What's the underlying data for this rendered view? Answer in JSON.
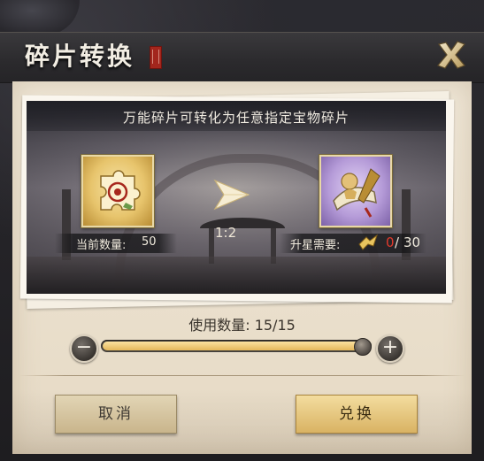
{
  "window": {
    "title": "碎片转换",
    "close_icon": "close-x-icon"
  },
  "conversion": {
    "description": "万能碎片可转化为任意指定宝物碎片",
    "source_item": {
      "icon": "universal-fragment-icon",
      "frame_color": "#e7c46c",
      "current_label": "当前数量:",
      "current_value": "50"
    },
    "ratio": "1:2",
    "target_item": {
      "icon": "treasure-scroll-icon",
      "frame_color": "#b59bd8",
      "need_label": "升星需要:",
      "need_icon": "star-fragment-icon",
      "have": "0",
      "separator": "/",
      "total": "30",
      "have_color": "#e23a2c"
    }
  },
  "usage": {
    "label": "使用数量:",
    "value": "15/15",
    "slider_fraction": 1.0,
    "minus_icon": "minus-icon",
    "plus_icon": "plus-icon"
  },
  "buttons": {
    "cancel": "取消",
    "confirm": "兑换"
  }
}
